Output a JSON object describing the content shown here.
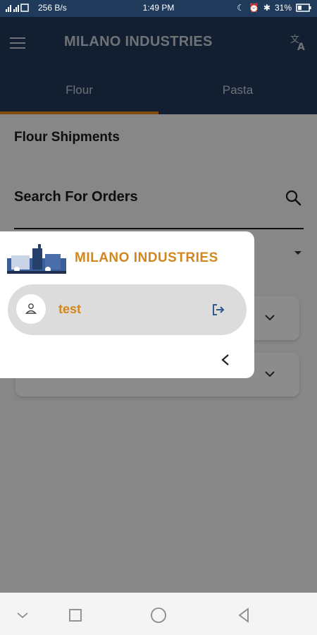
{
  "status_bar": {
    "speed": "256 B/s",
    "time": "1:49 PM",
    "battery": "31%"
  },
  "app_bar": {
    "title": "MILANO INDUSTRIES"
  },
  "tabs": [
    {
      "label": "Flour",
      "active": true
    },
    {
      "label": "Pasta",
      "active": false
    }
  ],
  "main": {
    "section_title": "Flour Shipments",
    "search_label": "Search For Orders"
  },
  "drawer": {
    "title": "MILANO INDUSTRIES",
    "user_name": "test"
  },
  "colors": {
    "appbar": "#1f3a5a",
    "accent": "#e58a1a",
    "brand_text": "#d4861e"
  },
  "icons": {
    "menu": "menu-icon",
    "translate": "translate-icon",
    "search": "search-icon",
    "user": "user-icon",
    "logout": "logout-icon",
    "collapse": "chevron-left-icon"
  }
}
